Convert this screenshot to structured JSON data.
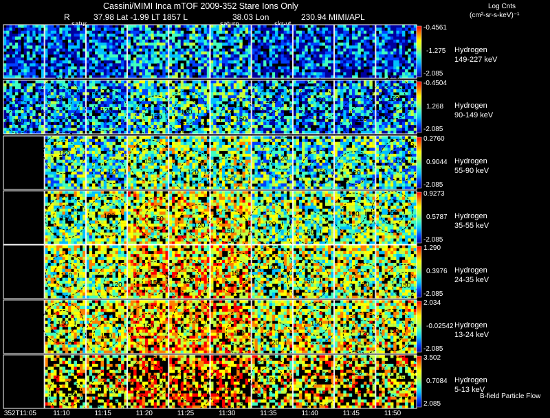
{
  "title": "Cassini/MIMI Inca mTOF  2009-352   Stare   Ions Only",
  "subtitle": {
    "r_label": "R",
    "position": "37.98 Lat -1.99 LT 1857 L",
    "lon": "38.03 Lon",
    "source": "230.94  MIMI/APL"
  },
  "units": {
    "line1": "Log Cnts",
    "line2": "(cm²-sr-s-keV)⁻¹"
  },
  "annotations": [
    "satur",
    "saturn",
    "skr-vt"
  ],
  "time_labels": [
    "352T11:05",
    "11:10",
    "11:15",
    "11:20",
    "11:25",
    "11:30",
    "11:35",
    "11:40",
    "11:45",
    "11:50"
  ],
  "footer_note": "B-field  Particle Flow",
  "contour_labels": [
    "120",
    "150"
  ],
  "chart_data": {
    "type": "heatmap",
    "title": "Cassini/MIMI Inca mTOF  2009-352   Stare   Ions Only",
    "x_ticks": [
      "352T11:05",
      "11:10",
      "11:15",
      "11:20",
      "11:25",
      "11:30",
      "11:35",
      "11:40",
      "11:45",
      "11:50"
    ],
    "colorbar_label": "Log Cnts (cm²-sr-s-keV)⁻¹",
    "colormap": [
      "#0000a0",
      "#0040ff",
      "#00c0ff",
      "#40ffc0",
      "#c0ff40",
      "#ffff00",
      "#ff8000",
      "#ff0000"
    ],
    "rows": [
      {
        "species": "Hydrogen",
        "energy": "149-227 keV",
        "cb_max": "-0.4561",
        "cb_mid": "-1.275",
        "cb_min": "-2.085",
        "empty_first": false,
        "level": 0.18
      },
      {
        "species": "Hydrogen",
        "energy": "90-149 keV",
        "cb_max": "-0.4504",
        "cb_mid": "1.268",
        "cb_min": "-2.085",
        "empty_first": false,
        "level": 0.28
      },
      {
        "species": "Hydrogen",
        "energy": "55-90 keV",
        "cb_max": "0.2760",
        "cb_mid": "0.9044",
        "cb_min": "-2.085",
        "empty_first": true,
        "level": 0.42
      },
      {
        "species": "Hydrogen",
        "energy": "35-55 keV",
        "cb_max": "0.9273",
        "cb_mid": "0.5787",
        "cb_min": "-2.085",
        "empty_first": true,
        "level": 0.52
      },
      {
        "species": "Hydrogen",
        "energy": "24-35 keV",
        "cb_max": "1.290",
        "cb_mid": "0.3976",
        "cb_min": "-2.085",
        "empty_first": true,
        "level": 0.58
      },
      {
        "species": "Hydrogen",
        "energy": "13-24 keV",
        "cb_max": "2.034",
        "cb_mid": "-0.02542",
        "cb_min": "-2.085",
        "empty_first": true,
        "level": 0.62
      },
      {
        "species": "Hydrogen",
        "energy": "5-13 keV",
        "cb_max": "3.502",
        "cb_mid": "0.7084",
        "cb_min": "2.085",
        "empty_first": true,
        "level": 0.66
      }
    ]
  }
}
